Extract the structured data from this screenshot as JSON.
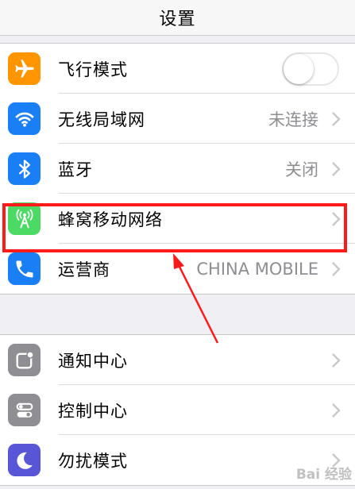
{
  "header": {
    "title": "设置"
  },
  "colors": {
    "airplane": "#ff9500",
    "wifi": "#1a7ef5",
    "bluetooth": "#1a7ef5",
    "cellular": "#4cd964",
    "carrier": "#1a7ef5",
    "notifications": "#8e8e93",
    "control_center": "#8e8e93",
    "dnd": "#5856d6",
    "annotation": "#ff1a1a"
  },
  "group1": {
    "airplane": {
      "label": "飞行模式",
      "toggle_on": false
    },
    "wifi": {
      "label": "无线局域网",
      "value": "未连接"
    },
    "bluetooth": {
      "label": "蓝牙",
      "value": "关闭"
    },
    "cellular": {
      "label": "蜂窝移动网络"
    },
    "carrier": {
      "label": "运营商",
      "value": "CHINA MOBILE"
    }
  },
  "group2": {
    "notifications": {
      "label": "通知中心"
    },
    "control_center": {
      "label": "控制中心"
    },
    "dnd": {
      "label": "勿扰模式"
    }
  },
  "watermark": {
    "text": "Bai 经验"
  }
}
